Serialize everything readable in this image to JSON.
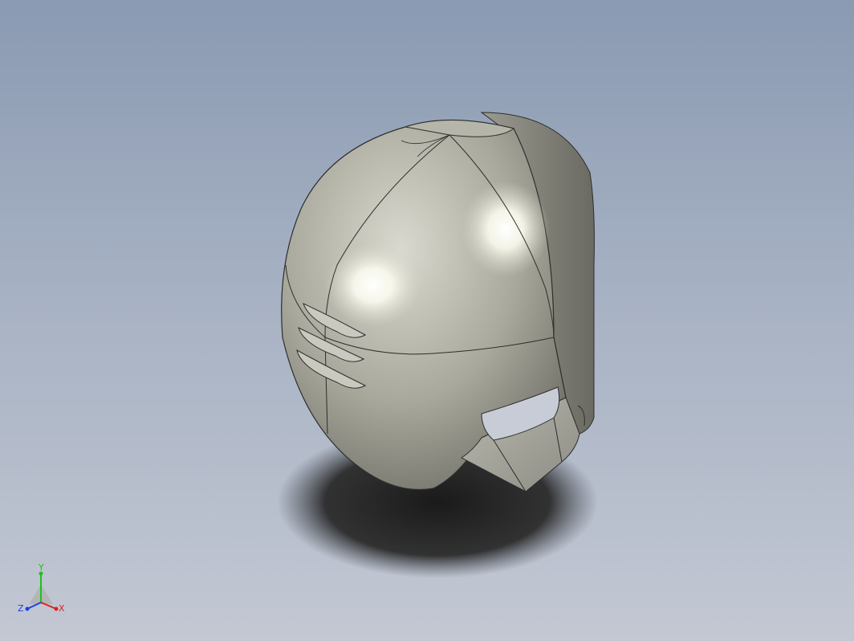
{
  "viewport": {
    "background_top": "#8a9ab2",
    "background_bottom": "#c3c8d3"
  },
  "model": {
    "part": "helmet",
    "shell_color": "#a9a99e",
    "highlight_color": "#ffffff",
    "shadow_color": "#222222"
  },
  "triad": {
    "x_label": "X",
    "y_label": "Y",
    "z_label": "Z",
    "x_color": "#e02020",
    "y_color": "#1fbf1f",
    "z_color": "#2040e0"
  }
}
